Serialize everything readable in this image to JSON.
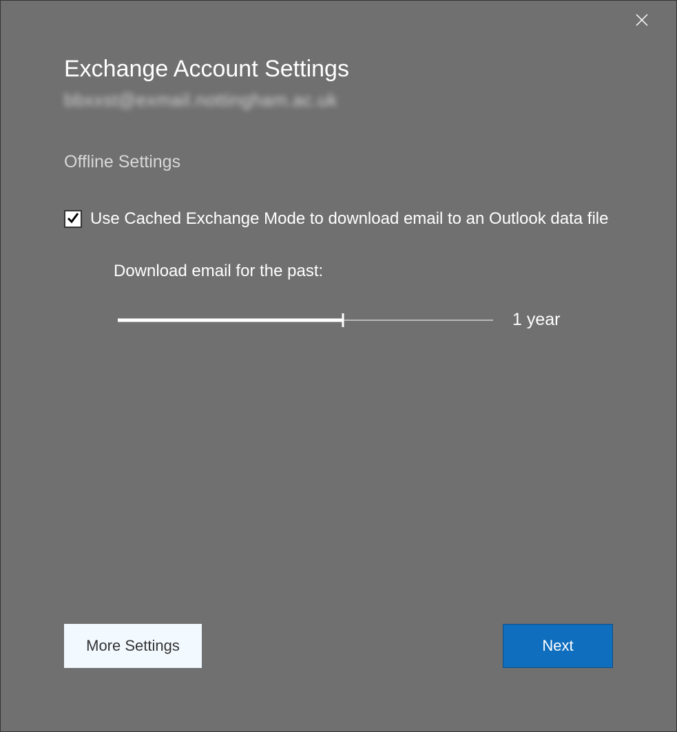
{
  "title": "Exchange Account Settings",
  "email_blurred": "bbxxst@exmail.nottingham.ac.uk",
  "section": "Offline Settings",
  "checkbox": {
    "checked": true,
    "label": "Use Cached Exchange Mode to download email to an Outlook data file"
  },
  "slider": {
    "label": "Download email for the past:",
    "value_label": "1 year",
    "percent": 60
  },
  "buttons": {
    "more_settings": "More Settings",
    "next": "Next"
  }
}
